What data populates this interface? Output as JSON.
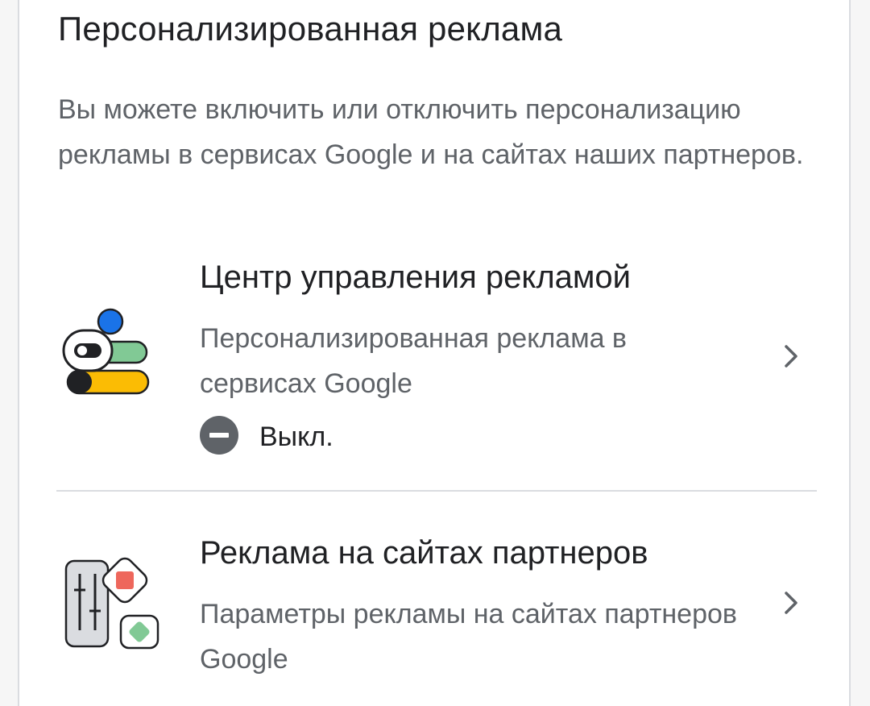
{
  "section": {
    "title": "Персонализированная реклама",
    "description": "Вы можете включить или отключить персонализацию рекламы в сервисах Google и на сайтах наших партнеров."
  },
  "items": [
    {
      "title": "Центр управления рекламой",
      "subtitle": "Персонализированная реклама в сервисах Google",
      "status": "Выкл.",
      "icon": "ad-center-toggles-icon",
      "status_icon": "minus-circle-icon"
    },
    {
      "title": "Реклама на сайтах партнеров",
      "subtitle": "Параметры рекламы на сайтах партнеров Google",
      "icon": "partner-sites-sliders-icon"
    }
  ],
  "colors": {
    "text_primary": "#202124",
    "text_secondary": "#5f6368",
    "divider": "#dadce0",
    "blue": "#1a73e8",
    "green": "#81c995",
    "yellow": "#fbbc04",
    "red": "#ee675c",
    "status_gray": "#5f6368"
  }
}
